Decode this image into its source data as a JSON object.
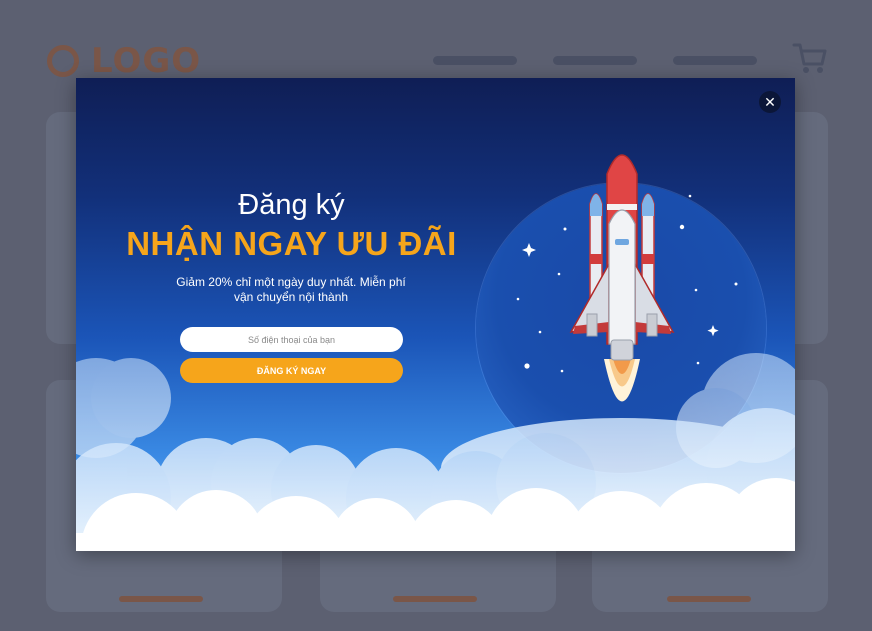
{
  "page": {
    "logo_text": "LOGO",
    "cart_icon": "cart-icon"
  },
  "popup": {
    "close_icon": "close-icon",
    "close_symbol": "✕",
    "title_line1": "Đăng ký",
    "title_line2": "NHẬN NGAY ƯU ĐÃI",
    "subtitle": "Giảm 20% chỉ một ngày duy nhất. Miễn phí vận chuyển nội thành",
    "phone_placeholder": "Số điện thoại của bạn",
    "phone_value": "",
    "submit_label": "ĐĂNG KÝ NGAY",
    "illustration": "rocket-launch-icon"
  },
  "colors": {
    "accent": "#f6a51b",
    "modal_top": "#0f1e55",
    "modal_mid": "#1b55b8",
    "backdrop": "#5c6071",
    "logo": "#7a5648"
  }
}
